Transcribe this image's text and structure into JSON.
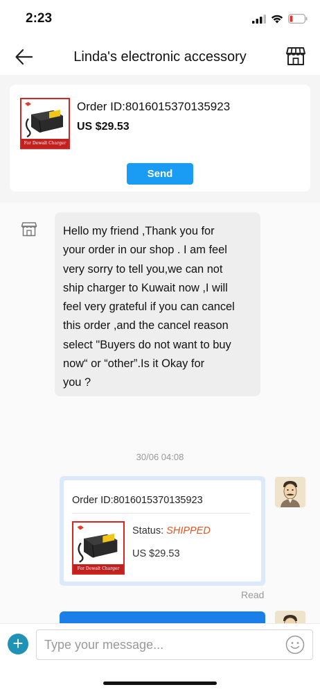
{
  "status_bar": {
    "time": "2:23",
    "battery_color": "#e5322d"
  },
  "nav": {
    "title": "Linda's electronic accessory",
    "back_icon": "arrow-left-icon",
    "store_icon": "storefront-icon"
  },
  "order_card": {
    "order_id": "Order ID:8016015370135923",
    "price": "US $29.53",
    "thumb_label": "For Dewalt Charger",
    "send_label": "Send"
  },
  "messages": {
    "seller_message": "Hello my friend ,Thank you for\nyour order in our shop . I am feel\nvery sorry to tell you,we can not\nship charger to Kuwait now ,I will\nfeel very grateful if you can cancel\nthis order ,and the cancel reason\nselect \"Buyers do not want to buy\nnow“ or “other”.Is it Okay for\nyou ?",
    "timestamp": "30/06 04:08",
    "order_bubble": {
      "order_id": "Order ID:8016015370135923",
      "status_label": "Status: ",
      "status_value": "SHIPPED",
      "price": "US $29.53",
      "thumb_label": "For Dewalt Charger"
    },
    "read_label": "Read"
  },
  "input": {
    "placeholder": "Type your message..."
  },
  "colors": {
    "accent_blue": "#1a9cf5",
    "status_shipped": "#e8531f",
    "plus_button": "#1e93b6",
    "thumb_border": "#d82323"
  }
}
